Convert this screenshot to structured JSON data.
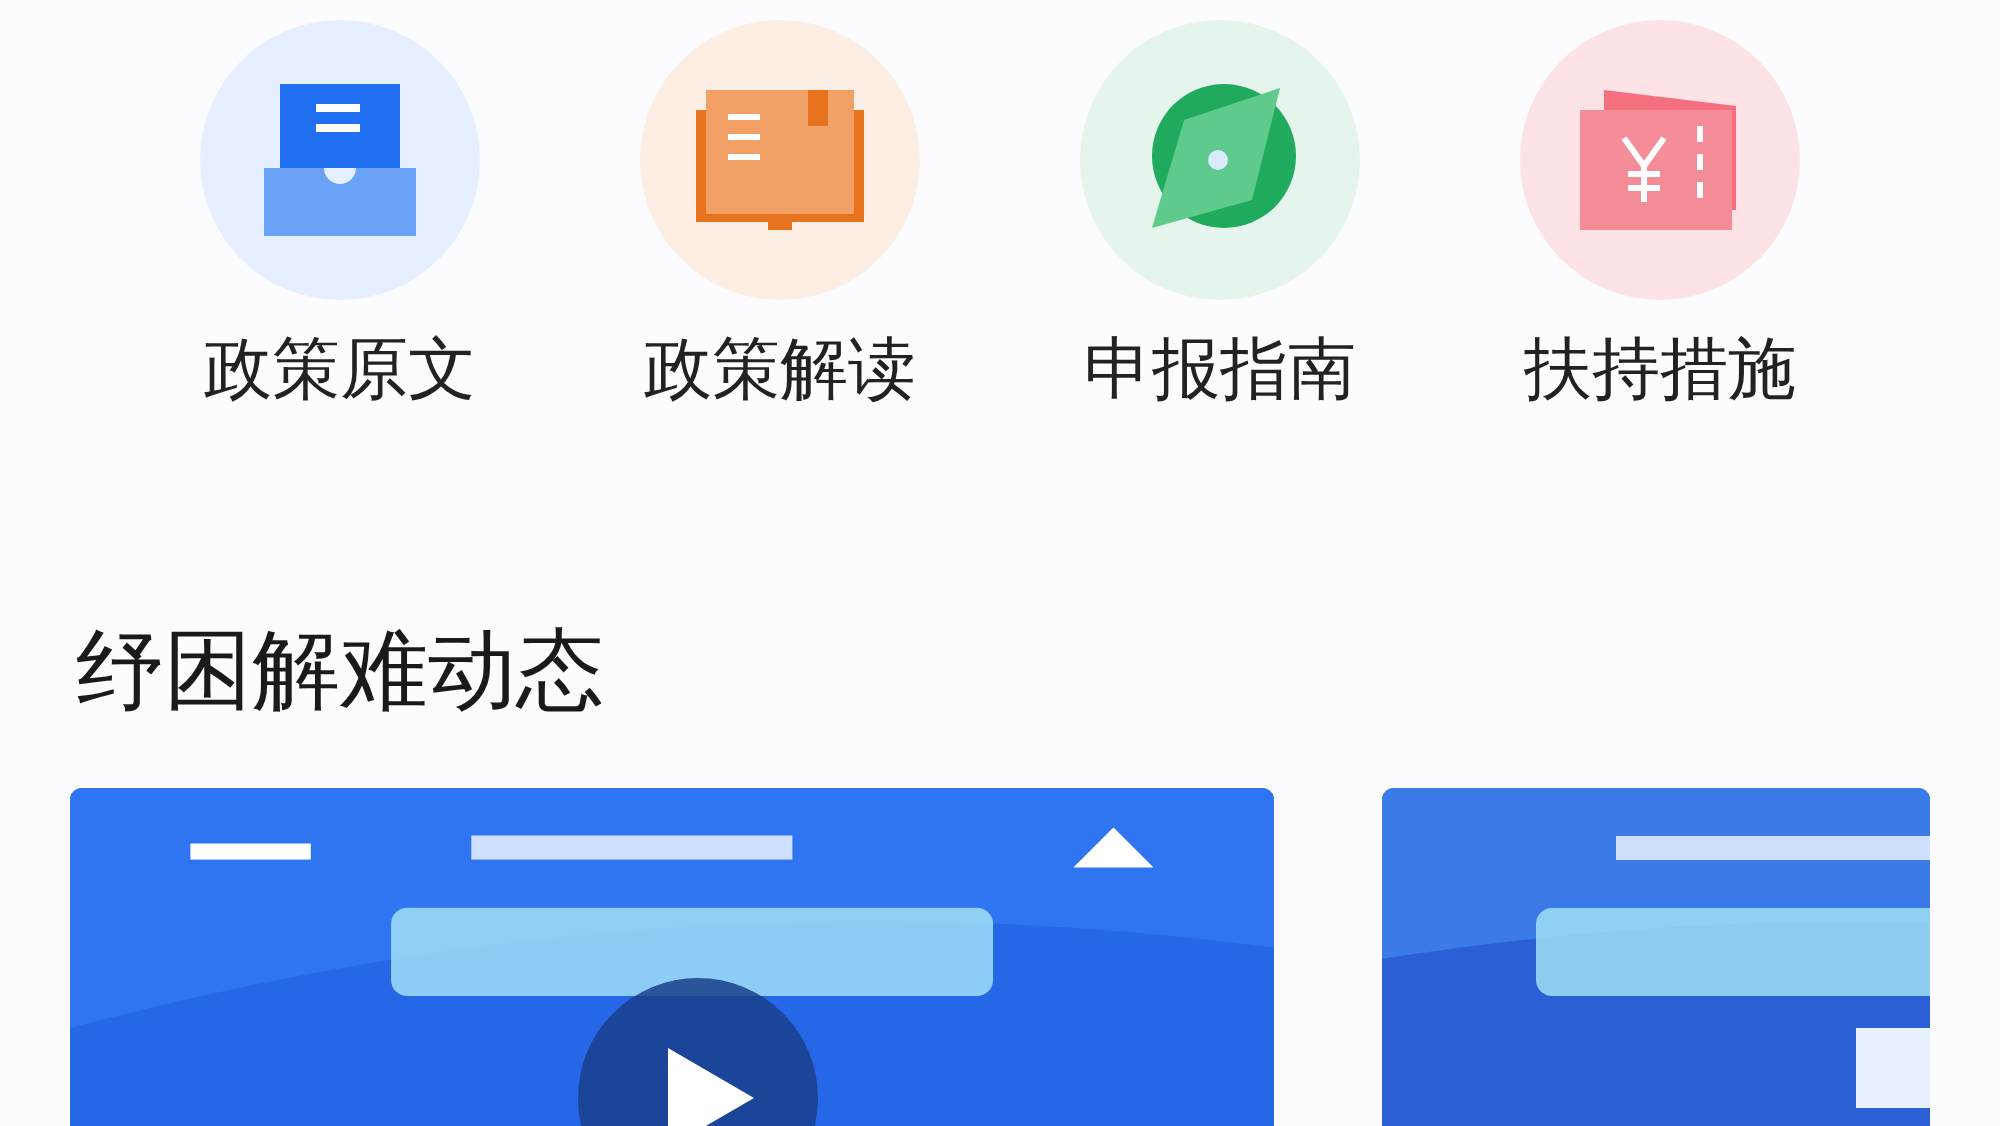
{
  "shortcuts": [
    {
      "label": "政策原文",
      "kind": "tray"
    },
    {
      "label": "政策解读",
      "kind": "book"
    },
    {
      "label": "申报指南",
      "kind": "compass"
    },
    {
      "label": "扶持措施",
      "kind": "ticket"
    }
  ],
  "section": {
    "title": "纾困解难动态"
  },
  "videos": [
    {
      "kind": "picture",
      "playable": true
    },
    {
      "kind": "picture",
      "playable": false
    }
  ]
}
